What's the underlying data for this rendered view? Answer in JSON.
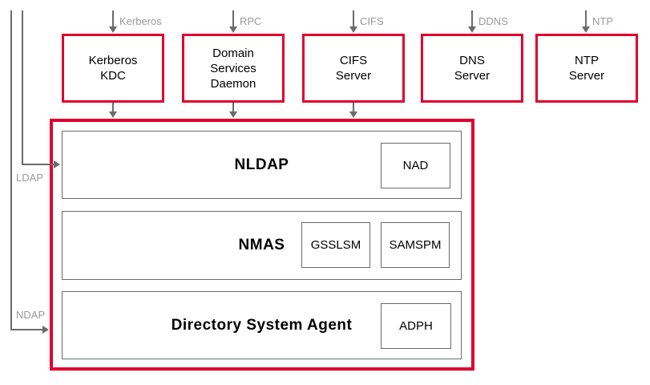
{
  "colors": {
    "accent_red": "#e0002e",
    "line_gray": "#6b6b6b",
    "flow_label_gray": "#9a9a9a",
    "text_black": "#000000"
  },
  "top_flows": [
    {
      "protocol": "Kerberos"
    },
    {
      "protocol": "RPC"
    },
    {
      "protocol": "CIFS"
    },
    {
      "protocol": "DDNS"
    },
    {
      "protocol": "NTP"
    }
  ],
  "top_boxes": [
    {
      "lines": [
        "Kerberos",
        "KDC"
      ]
    },
    {
      "lines": [
        "Domain",
        "Services",
        "Daemon"
      ]
    },
    {
      "lines": [
        "CIFS",
        "Server"
      ]
    },
    {
      "lines": [
        "DNS",
        "Server"
      ]
    },
    {
      "lines": [
        "NTP",
        "Server"
      ]
    }
  ],
  "side_flows": [
    {
      "protocol": "LDAP"
    },
    {
      "protocol": "NDAP"
    }
  ],
  "stack": {
    "rows": [
      {
        "title": "NLDAP",
        "modules": [
          "NAD"
        ]
      },
      {
        "title": "NMAS",
        "modules": [
          "GSSLSM",
          "SAMSPM"
        ]
      },
      {
        "title": "Directory System Agent",
        "modules": [
          "ADPH"
        ]
      }
    ]
  }
}
